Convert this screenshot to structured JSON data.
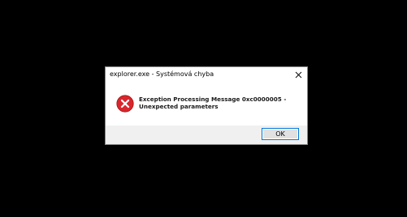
{
  "dialog": {
    "title": "explorer.exe - Systémová chyba",
    "message": "Exception Processing Message 0xc0000005 - Unexpected parameters",
    "ok_label": "OK",
    "icon": "error-icon",
    "colors": {
      "background": "#000000",
      "error_red": "#d9262d",
      "button_border": "#0078d7"
    }
  }
}
